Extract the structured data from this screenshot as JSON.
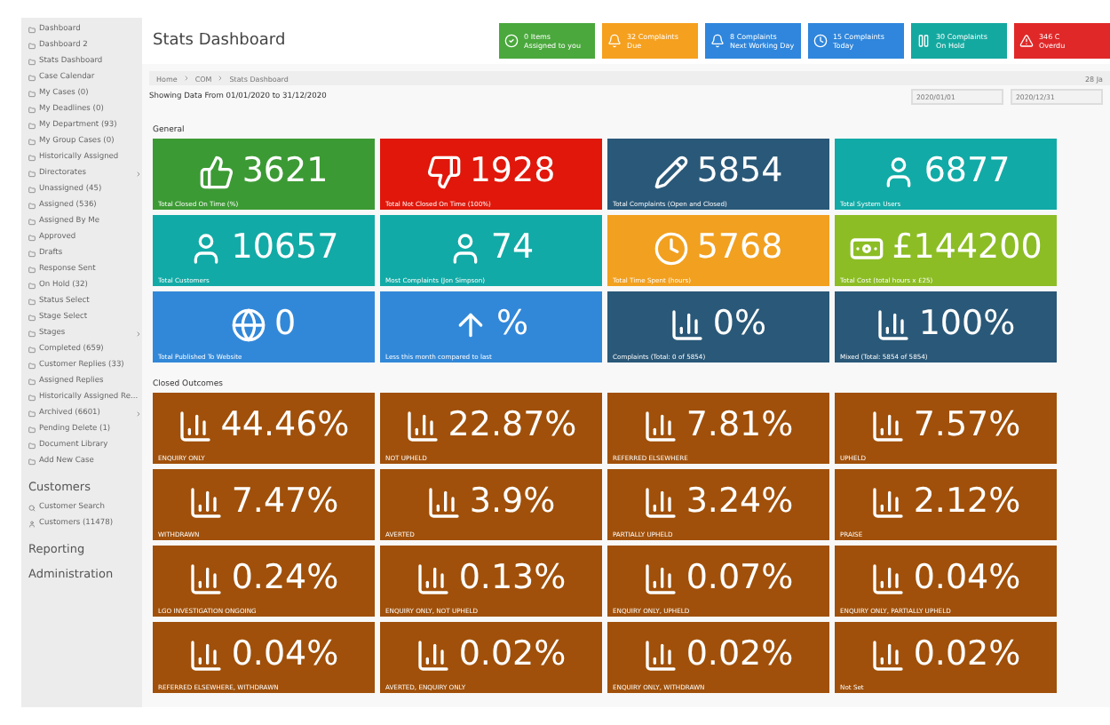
{
  "sidebar": {
    "items": [
      {
        "label": "Dashboard",
        "expandable": false
      },
      {
        "label": "Dashboard 2",
        "expandable": false
      },
      {
        "label": "Stats Dashboard",
        "expandable": false
      },
      {
        "label": "Case Calendar",
        "expandable": false
      },
      {
        "label": "My Cases (0)",
        "expandable": false
      },
      {
        "label": "My Deadlines (0)",
        "expandable": false
      },
      {
        "label": "My Department (93)",
        "expandable": false
      },
      {
        "label": "My Group Cases (0)",
        "expandable": false
      },
      {
        "label": "Historically Assigned",
        "expandable": false
      },
      {
        "label": "Directorates",
        "expandable": true
      },
      {
        "label": "Unassigned (45)",
        "expandable": false
      },
      {
        "label": "Assigned (536)",
        "expandable": false
      },
      {
        "label": "Assigned By Me",
        "expandable": false
      },
      {
        "label": "Approved",
        "expandable": false
      },
      {
        "label": "Drafts",
        "expandable": false
      },
      {
        "label": "Response Sent",
        "expandable": false
      },
      {
        "label": "On Hold (32)",
        "expandable": false
      },
      {
        "label": "Status Select",
        "expandable": false
      },
      {
        "label": "Stage Select",
        "expandable": false
      },
      {
        "label": "Stages",
        "expandable": true
      },
      {
        "label": "Completed (659)",
        "expandable": false
      },
      {
        "label": "Customer Replies (33)",
        "expandable": false
      },
      {
        "label": "Assigned Replies",
        "expandable": false
      },
      {
        "label": "Historically Assigned Re...",
        "expandable": false
      },
      {
        "label": "Archived (6601)",
        "expandable": true
      },
      {
        "label": "Pending Delete (1)",
        "expandable": false
      },
      {
        "label": "Document Library",
        "expandable": false
      },
      {
        "label": "Add New Case",
        "expandable": false
      }
    ],
    "sections": [
      {
        "heading": "Customers",
        "items": [
          "Customer Search",
          "Customers (11478)"
        ]
      },
      {
        "heading": "Reporting"
      },
      {
        "heading": "Administration"
      }
    ]
  },
  "header": {
    "title": "Stats Dashboard",
    "buttons": [
      {
        "line1": "0 Items",
        "line2": "Assigned to you",
        "color": "#4aa83c"
      },
      {
        "line1": "32 Complaints",
        "line2": "Due",
        "color": "#f5a01e"
      },
      {
        "line1": "8 Complaints",
        "line2": "Next Working Day",
        "color": "#2f86dc"
      },
      {
        "line1": "15 Complaints",
        "line2": "Today",
        "color": "#2f86dc"
      },
      {
        "line1": "30 Complaints",
        "line2": "On Hold",
        "color": "#14a9a0"
      },
      {
        "line1": "346 C",
        "line2": "Overdu",
        "color": "#e02828"
      }
    ]
  },
  "breadcrumb": {
    "items": [
      "Home",
      "COM",
      "Stats Dashboard"
    ],
    "date": "28 Ja"
  },
  "range": {
    "text": "Showing Data From 01/01/2020 to 31/12/2020",
    "from": "2020/01/01",
    "to": "2020/12/31"
  },
  "general": {
    "heading": "General",
    "tiles": [
      {
        "value": "3621",
        "label": "Total Closed On Time (%)",
        "color": "#3c9a34"
      },
      {
        "value": "1928",
        "label": "Total Not Closed On Time (100%)",
        "color": "#e0170a"
      },
      {
        "value": "5854",
        "label": "Total Complaints (Open and Closed)",
        "color": "#2a5878"
      },
      {
        "value": "6877",
        "label": "Total System Users",
        "color": "#12aaa6"
      },
      {
        "value": "10657",
        "label": "Total Customers",
        "color": "#12aaa6"
      },
      {
        "value": "74",
        "label": "Most Complaints (Jon Simpson)",
        "color": "#12aaa6"
      },
      {
        "value": "5768",
        "label": "Total Time Spent (hours)",
        "color": "#f2a01f"
      },
      {
        "value": "£144200",
        "label": "Total Cost (total hours x £25)",
        "color": "#8cbd25"
      },
      {
        "value": "0",
        "label": "Total Published To Website",
        "color": "#3288d8"
      },
      {
        "value": "%",
        "label": "Less this month compared to last",
        "color": "#3288d8"
      },
      {
        "value": "0%",
        "label": "Complaints (Total: 0 of 5854)",
        "color": "#2a5878"
      },
      {
        "value": "100%",
        "label": "Mixed (Total: 5854 of 5854)",
        "color": "#2a5878"
      }
    ]
  },
  "outcomes": {
    "heading": "Closed Outcomes",
    "tiles": [
      {
        "value": "44.46%",
        "label": "ENQUIRY ONLY"
      },
      {
        "value": "22.87%",
        "label": "NOT UPHELD"
      },
      {
        "value": "7.81%",
        "label": "REFERRED ELSEWHERE"
      },
      {
        "value": "7.57%",
        "label": "UPHELD"
      },
      {
        "value": "7.47%",
        "label": "WITHDRAWN"
      },
      {
        "value": "3.9%",
        "label": "AVERTED"
      },
      {
        "value": "3.24%",
        "label": "PARTIALLY UPHELD"
      },
      {
        "value": "2.12%",
        "label": "PRAISE"
      },
      {
        "value": "0.24%",
        "label": "LGO INVESTIGATION ONGOING"
      },
      {
        "value": "0.13%",
        "label": "ENQUIRY ONLY, NOT UPHELD"
      },
      {
        "value": "0.07%",
        "label": "ENQUIRY ONLY, UPHELD"
      },
      {
        "value": "0.04%",
        "label": "ENQUIRY ONLY, PARTIALLY UPHELD"
      },
      {
        "value": "0.04%",
        "label": "REFERRED ELSEWHERE, WITHDRAWN"
      },
      {
        "value": "0.02%",
        "label": "AVERTED, ENQUIRY ONLY"
      },
      {
        "value": "0.02%",
        "label": "ENQUIRY ONLY, WITHDRAWN"
      },
      {
        "value": "0.02%",
        "label": "Not Set"
      }
    ]
  }
}
